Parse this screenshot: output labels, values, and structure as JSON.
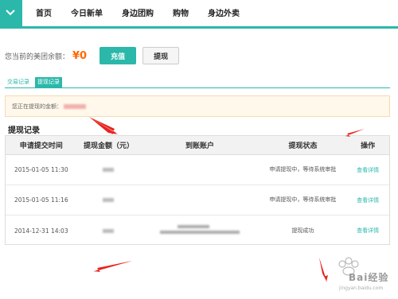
{
  "nav": {
    "items": [
      "首页",
      "今日新单",
      "身边团购",
      "购物",
      "身边外卖"
    ]
  },
  "balance": {
    "label": "您当前的美团余额：",
    "value": "¥0",
    "charge_label": "充值",
    "withdraw_label": "提现"
  },
  "subtabs": {
    "records": "交易记录",
    "withdraw_records": "提现记录"
  },
  "notice": {
    "text": "您正在提现的金额："
  },
  "section_title": "提现记录",
  "table": {
    "headers": [
      "申请提交时间",
      "提现金额（元）",
      "到账账户",
      "提现状态",
      "操作"
    ],
    "rows": [
      {
        "time": "2015-01-05 11:30",
        "status": "申请提现中，等待系统审批",
        "action": "查看详情"
      },
      {
        "time": "2015-01-05 11:16",
        "status": "申请提现中，等待系统审批",
        "action": "查看详情"
      },
      {
        "time": "2014-12-31 14:03",
        "status": "提现成功",
        "action": "查看详情"
      }
    ]
  },
  "watermark": {
    "text": "Bai经验",
    "url": "jingyan.baidu.com"
  },
  "colors": {
    "accent": "#2bb8aa",
    "balance": "#ff6a00",
    "annotation": "#e8231f"
  }
}
